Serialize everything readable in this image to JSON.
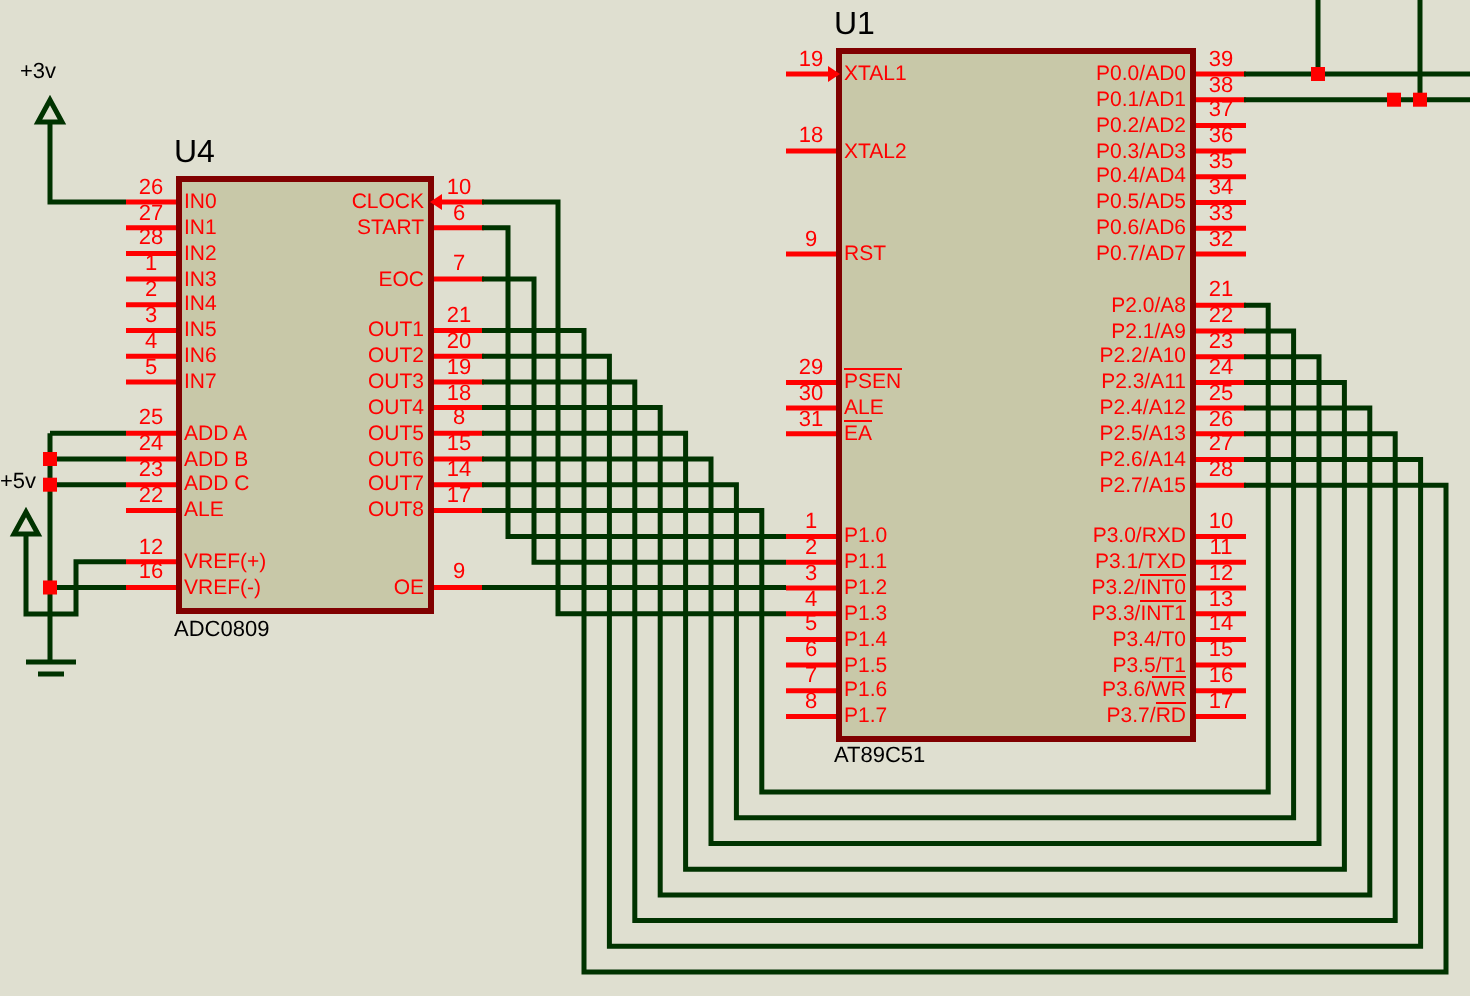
{
  "power": [
    {
      "kind": "supply",
      "label": "+3v"
    },
    {
      "kind": "supply",
      "label": "+5v"
    },
    {
      "kind": "ground"
    }
  ],
  "chips": [
    {
      "ref": "U4",
      "part": "ADC0809",
      "pins_left": [
        {
          "number": "26",
          "label": "IN0"
        },
        {
          "number": "27",
          "label": "IN1"
        },
        {
          "number": "28",
          "label": "IN2"
        },
        {
          "number": "1",
          "label": "IN3"
        },
        {
          "number": "2",
          "label": "IN4"
        },
        {
          "number": "3",
          "label": "IN5"
        },
        {
          "number": "4",
          "label": "IN6"
        },
        {
          "number": "5",
          "label": "IN7"
        },
        {
          "number": "25",
          "label": "ADD A"
        },
        {
          "number": "24",
          "label": "ADD B"
        },
        {
          "number": "23",
          "label": "ADD C"
        },
        {
          "number": "22",
          "label": "ALE"
        },
        {
          "number": "12",
          "label": "VREF(+)"
        },
        {
          "number": "16",
          "label": "VREF(-)"
        }
      ],
      "pins_right": [
        {
          "number": "10",
          "label": "CLOCK",
          "clock": true
        },
        {
          "number": "6",
          "label": "START"
        },
        {
          "number": "7",
          "label": "EOC"
        },
        {
          "number": "21",
          "label": "OUT1"
        },
        {
          "number": "20",
          "label": "OUT2"
        },
        {
          "number": "19",
          "label": "OUT3"
        },
        {
          "number": "18",
          "label": "OUT4"
        },
        {
          "number": "8",
          "label": "OUT5"
        },
        {
          "number": "15",
          "label": "OUT6"
        },
        {
          "number": "14",
          "label": "OUT7"
        },
        {
          "number": "17",
          "label": "OUT8"
        },
        {
          "number": "9",
          "label": "OE"
        }
      ]
    },
    {
      "ref": "U1",
      "part": "AT89C51",
      "pins_left": [
        {
          "number": "19",
          "label": "XTAL1",
          "clock": true
        },
        {
          "number": "18",
          "label": "XTAL2"
        },
        {
          "number": "9",
          "label": "RST"
        },
        {
          "number": "29",
          "negated": "PSEN"
        },
        {
          "number": "30",
          "label": "ALE"
        },
        {
          "number": "31",
          "negated": "EA"
        },
        {
          "number": "1",
          "label": "P1.0"
        },
        {
          "number": "2",
          "label": "P1.1"
        },
        {
          "number": "3",
          "label": "P1.2"
        },
        {
          "number": "4",
          "label": "P1.3"
        },
        {
          "number": "5",
          "label": "P1.4"
        },
        {
          "number": "6",
          "label": "P1.5"
        },
        {
          "number": "7",
          "label": "P1.6"
        },
        {
          "number": "8",
          "label": "P1.7"
        }
      ],
      "pins_right": [
        {
          "number": "39",
          "label": "P0.0/AD0"
        },
        {
          "number": "38",
          "label": "P0.1/AD1"
        },
        {
          "number": "37",
          "label": "P0.2/AD2"
        },
        {
          "number": "36",
          "label": "P0.3/AD3"
        },
        {
          "number": "35",
          "label": "P0.4/AD4"
        },
        {
          "number": "34",
          "label": "P0.5/AD5"
        },
        {
          "number": "33",
          "label": "P0.6/AD6"
        },
        {
          "number": "32",
          "label": "P0.7/AD7"
        },
        {
          "number": "21",
          "label": "P2.0/A8"
        },
        {
          "number": "22",
          "label": "P2.1/A9"
        },
        {
          "number": "23",
          "label": "P2.2/A10"
        },
        {
          "number": "24",
          "label": "P2.3/A11"
        },
        {
          "number": "25",
          "label": "P2.4/A12"
        },
        {
          "number": "26",
          "label": "P2.5/A13"
        },
        {
          "number": "27",
          "label": "P2.6/A14"
        },
        {
          "number": "28",
          "label": "P2.7/A15"
        },
        {
          "number": "10",
          "label": "P3.0/RXD"
        },
        {
          "number": "11",
          "label": "P3.1/TXD"
        },
        {
          "number": "12",
          "label": "P3.2/",
          "negated": "INT0"
        },
        {
          "number": "13",
          "label": "P3.3/",
          "negated": "INT1"
        },
        {
          "number": "14",
          "label": "P3.4/T0"
        },
        {
          "number": "15",
          "label": "P3.5/T1"
        },
        {
          "number": "16",
          "label": "P3.6/",
          "negated": "WR"
        },
        {
          "number": "17",
          "label": "P3.7/",
          "negated": "RD"
        }
      ]
    }
  ]
}
